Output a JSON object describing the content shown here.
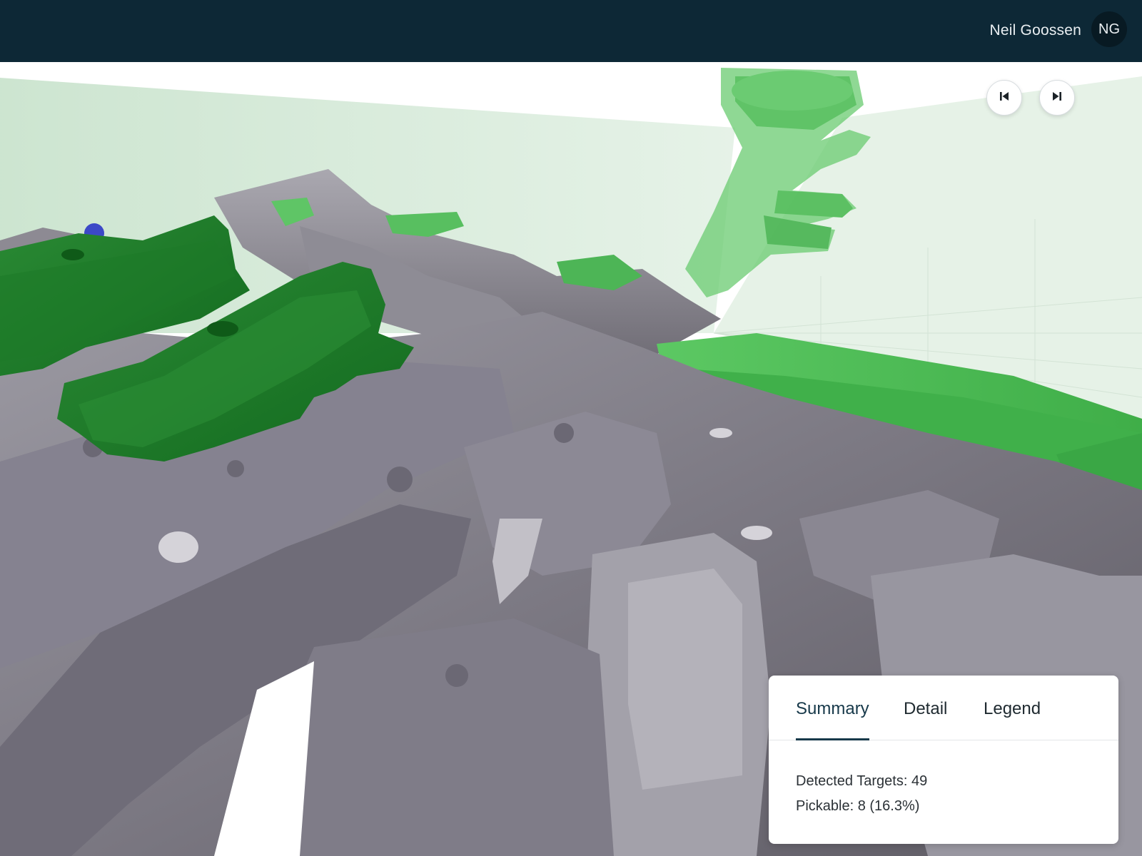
{
  "header": {
    "user_name": "Neil Goossen",
    "user_initials": "NG"
  },
  "viewer": {
    "prev_button_icon": "skip-previous-icon",
    "next_button_icon": "skip-next-icon"
  },
  "panel": {
    "tabs": [
      {
        "label": "Summary",
        "active": true
      },
      {
        "label": "Detail",
        "active": false
      },
      {
        "label": "Legend",
        "active": false
      }
    ],
    "summary": {
      "detected_targets": "Detected Targets: 49",
      "pickable": "Pickable: 8 (16.3%)"
    }
  },
  "colors": {
    "header_bg": "#0d2836",
    "pickable_green": "#2f9a3a",
    "part_grey": "#7d7a84",
    "workspace_tint": "#cfe6d2"
  }
}
